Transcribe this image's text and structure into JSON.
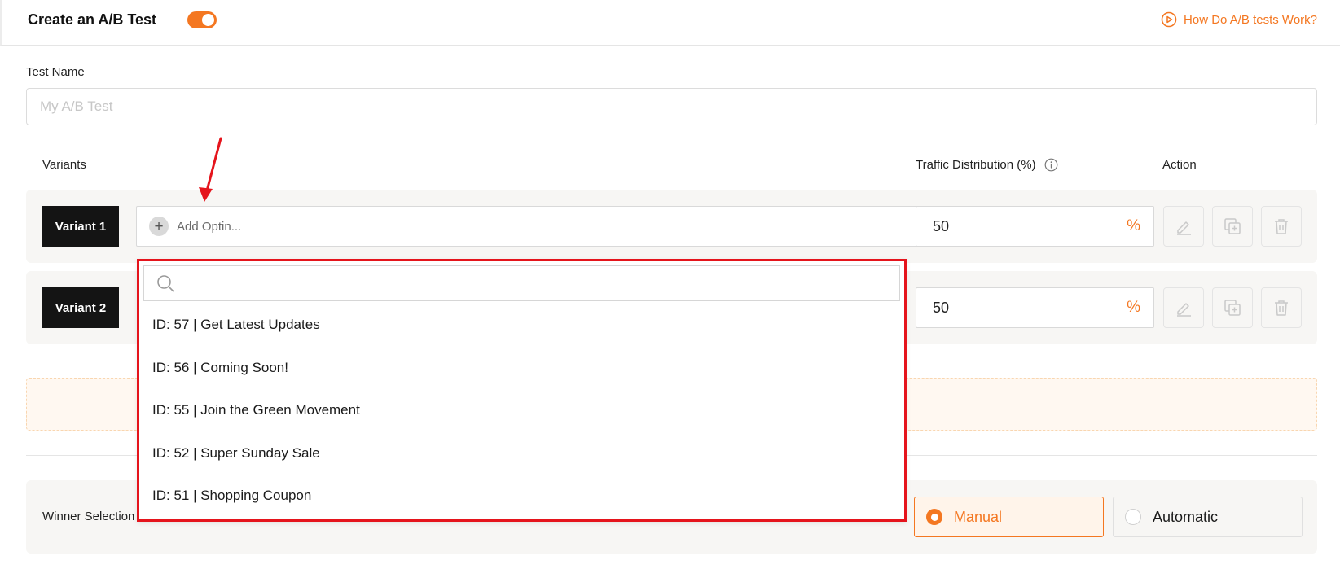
{
  "header": {
    "title": "Create an A/B Test",
    "help_link": "How Do A/B tests Work?"
  },
  "test_name": {
    "label": "Test Name",
    "placeholder": "My A/B Test",
    "value": ""
  },
  "table": {
    "col_variants": "Variants",
    "col_traffic": "Traffic Distribution (%)",
    "col_action": "Action",
    "percent_symbol": "%"
  },
  "variants": [
    {
      "label": "Variant 1",
      "optin_placeholder": "Add Optin...",
      "traffic": "50"
    },
    {
      "label": "Variant 2",
      "traffic": "50"
    }
  ],
  "dropdown": {
    "search_value": "",
    "options": [
      "ID: 57 | Get Latest Updates",
      "ID: 56 | Coming Soon!",
      "ID: 55 | Join the Green Movement",
      "ID: 52 | Super Sunday Sale",
      "ID: 51 | Shopping Coupon"
    ]
  },
  "winner": {
    "label": "Winner Selection",
    "options": [
      "Manual",
      "Automatic"
    ],
    "selected": "Manual"
  },
  "colors": {
    "accent": "#f47721",
    "badge": "#141414",
    "highlight": "#e5141c"
  },
  "icons": [
    "play-circle-icon",
    "info-icon",
    "plus-icon",
    "edit-icon",
    "duplicate-icon",
    "trash-icon",
    "search-icon",
    "arrow-annotation-icon"
  ]
}
